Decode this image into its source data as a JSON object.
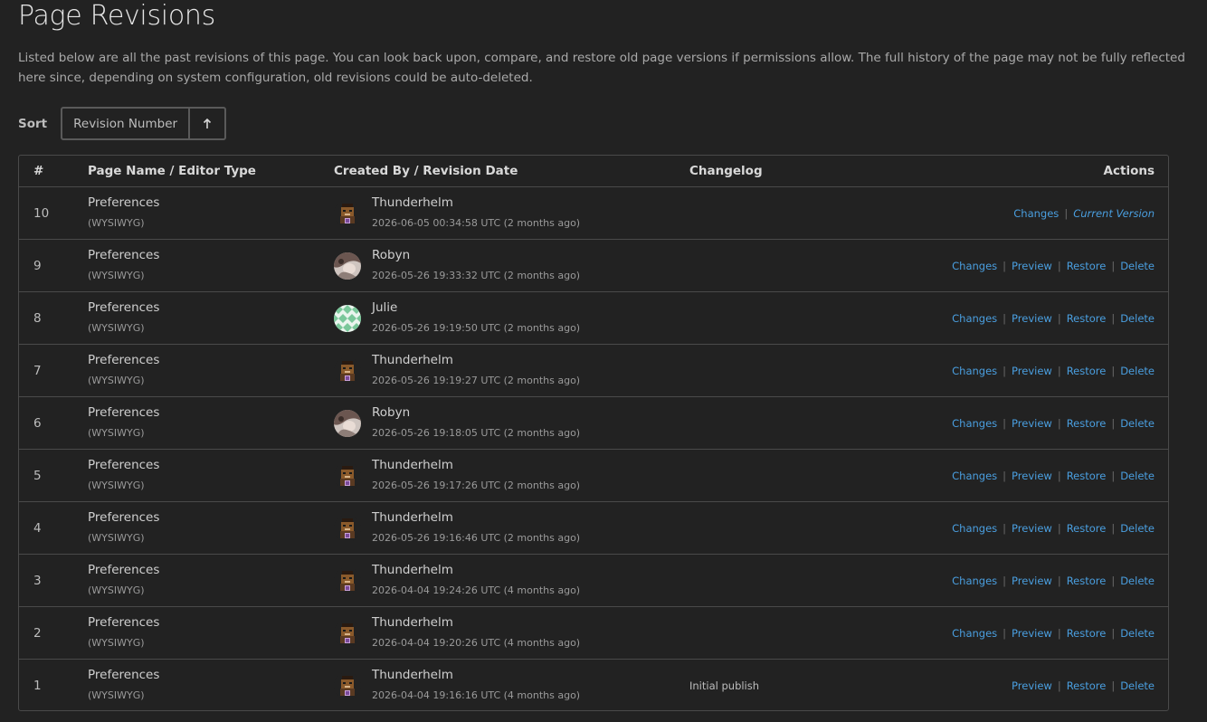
{
  "page": {
    "title": "Page Revisions",
    "intro": "Listed below are all the past revisions of this page. You can look back upon, compare, and restore old page versions if permissions allow. The full history of the page may not be fully reflected here since, depending on system configuration, old revisions could be auto-deleted."
  },
  "sort": {
    "label": "Sort",
    "selected": "Revision Number",
    "direction_icon": "arrow-up-icon"
  },
  "table": {
    "headers": {
      "num": "#",
      "page": "Page Name / Editor Type",
      "created": "Created By / Revision Date",
      "changelog": "Changelog",
      "actions": "Actions"
    },
    "rows": [
      {
        "num": "10",
        "page": "Preferences",
        "editor": "(WYSIWYG)",
        "user": "Thunderhelm",
        "avatar": "thunderhelm",
        "date": "2026-06-05 00:34:58 UTC (2 months ago)",
        "changelog": "",
        "actions": [
          "Changes",
          "Current Version"
        ]
      },
      {
        "num": "9",
        "page": "Preferences",
        "editor": "(WYSIWYG)",
        "user": "Robyn",
        "avatar": "robyn",
        "date": "2026-05-26 19:33:32 UTC (2 months ago)",
        "changelog": "",
        "actions": [
          "Changes",
          "Preview",
          "Restore",
          "Delete"
        ]
      },
      {
        "num": "8",
        "page": "Preferences",
        "editor": "(WYSIWYG)",
        "user": "Julie",
        "avatar": "julie",
        "date": "2026-05-26 19:19:50 UTC (2 months ago)",
        "changelog": "",
        "actions": [
          "Changes",
          "Preview",
          "Restore",
          "Delete"
        ]
      },
      {
        "num": "7",
        "page": "Preferences",
        "editor": "(WYSIWYG)",
        "user": "Thunderhelm",
        "avatar": "thunderhelm",
        "date": "2026-05-26 19:19:27 UTC (2 months ago)",
        "changelog": "",
        "actions": [
          "Changes",
          "Preview",
          "Restore",
          "Delete"
        ]
      },
      {
        "num": "6",
        "page": "Preferences",
        "editor": "(WYSIWYG)",
        "user": "Robyn",
        "avatar": "robyn",
        "date": "2026-05-26 19:18:05 UTC (2 months ago)",
        "changelog": "",
        "actions": [
          "Changes",
          "Preview",
          "Restore",
          "Delete"
        ]
      },
      {
        "num": "5",
        "page": "Preferences",
        "editor": "(WYSIWYG)",
        "user": "Thunderhelm",
        "avatar": "thunderhelm",
        "date": "2026-05-26 19:17:26 UTC (2 months ago)",
        "changelog": "",
        "actions": [
          "Changes",
          "Preview",
          "Restore",
          "Delete"
        ]
      },
      {
        "num": "4",
        "page": "Preferences",
        "editor": "(WYSIWYG)",
        "user": "Thunderhelm",
        "avatar": "thunderhelm",
        "date": "2026-05-26 19:16:46 UTC (2 months ago)",
        "changelog": "",
        "actions": [
          "Changes",
          "Preview",
          "Restore",
          "Delete"
        ]
      },
      {
        "num": "3",
        "page": "Preferences",
        "editor": "(WYSIWYG)",
        "user": "Thunderhelm",
        "avatar": "thunderhelm",
        "date": "2026-04-04 19:24:26 UTC (4 months ago)",
        "changelog": "",
        "actions": [
          "Changes",
          "Preview",
          "Restore",
          "Delete"
        ]
      },
      {
        "num": "2",
        "page": "Preferences",
        "editor": "(WYSIWYG)",
        "user": "Thunderhelm",
        "avatar": "thunderhelm",
        "date": "2026-04-04 19:20:26 UTC (4 months ago)",
        "changelog": "",
        "actions": [
          "Changes",
          "Preview",
          "Restore",
          "Delete"
        ]
      },
      {
        "num": "1",
        "page": "Preferences",
        "editor": "(WYSIWYG)",
        "user": "Thunderhelm",
        "avatar": "thunderhelm",
        "date": "2026-04-04 19:16:16 UTC (4 months ago)",
        "changelog": "Initial publish",
        "actions": [
          "Preview",
          "Restore",
          "Delete"
        ]
      }
    ]
  }
}
